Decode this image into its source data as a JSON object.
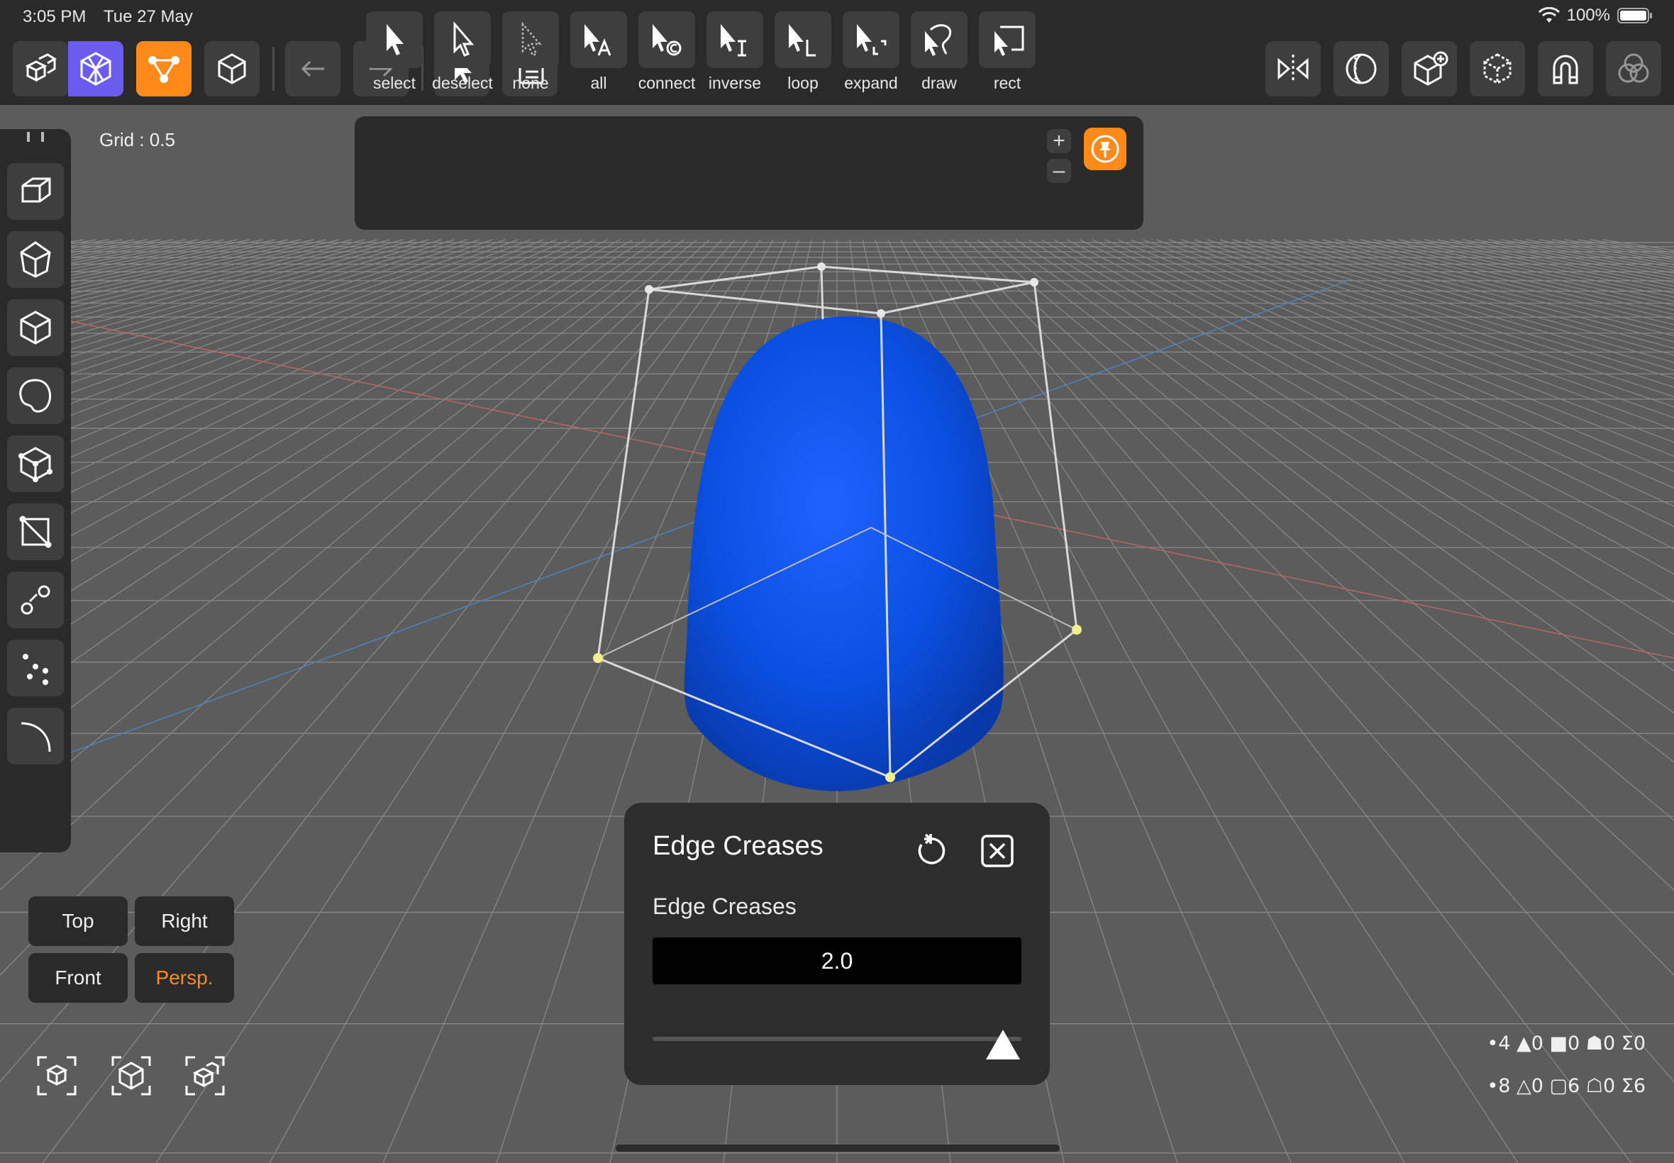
{
  "status": {
    "time": "3:05 PM",
    "date": "Tue 27 May",
    "battery": "100%"
  },
  "grid": {
    "label": "Grid : 0.5"
  },
  "selection_tools": [
    {
      "label": "select"
    },
    {
      "label": "deselect"
    },
    {
      "label": "none"
    },
    {
      "label": "all"
    },
    {
      "label": "connect"
    },
    {
      "label": "inverse"
    },
    {
      "label": "loop"
    },
    {
      "label": "expand"
    },
    {
      "label": "draw"
    },
    {
      "label": "rect"
    }
  ],
  "plus_label": "+",
  "minus_label": "–",
  "crease_panel": {
    "title": "Edge Creases",
    "field_label": "Edge Creases",
    "value": "2.0",
    "slider_fraction": 1.0
  },
  "views": {
    "top": "Top",
    "right": "Right",
    "front": "Front",
    "persp": "Persp."
  },
  "stats": {
    "line1": "•4 ▲0 ■0 ☗0 Σ0",
    "line2": "•8 △0 ▢6 ☖0 Σ6"
  },
  "colors": {
    "accent_orange": "#ff8a1a",
    "accent_purple": "#6b5cf0",
    "object_blue": "#0a4fe0",
    "x_axis": "#c0675f",
    "y_axis": "#4a86c8"
  }
}
